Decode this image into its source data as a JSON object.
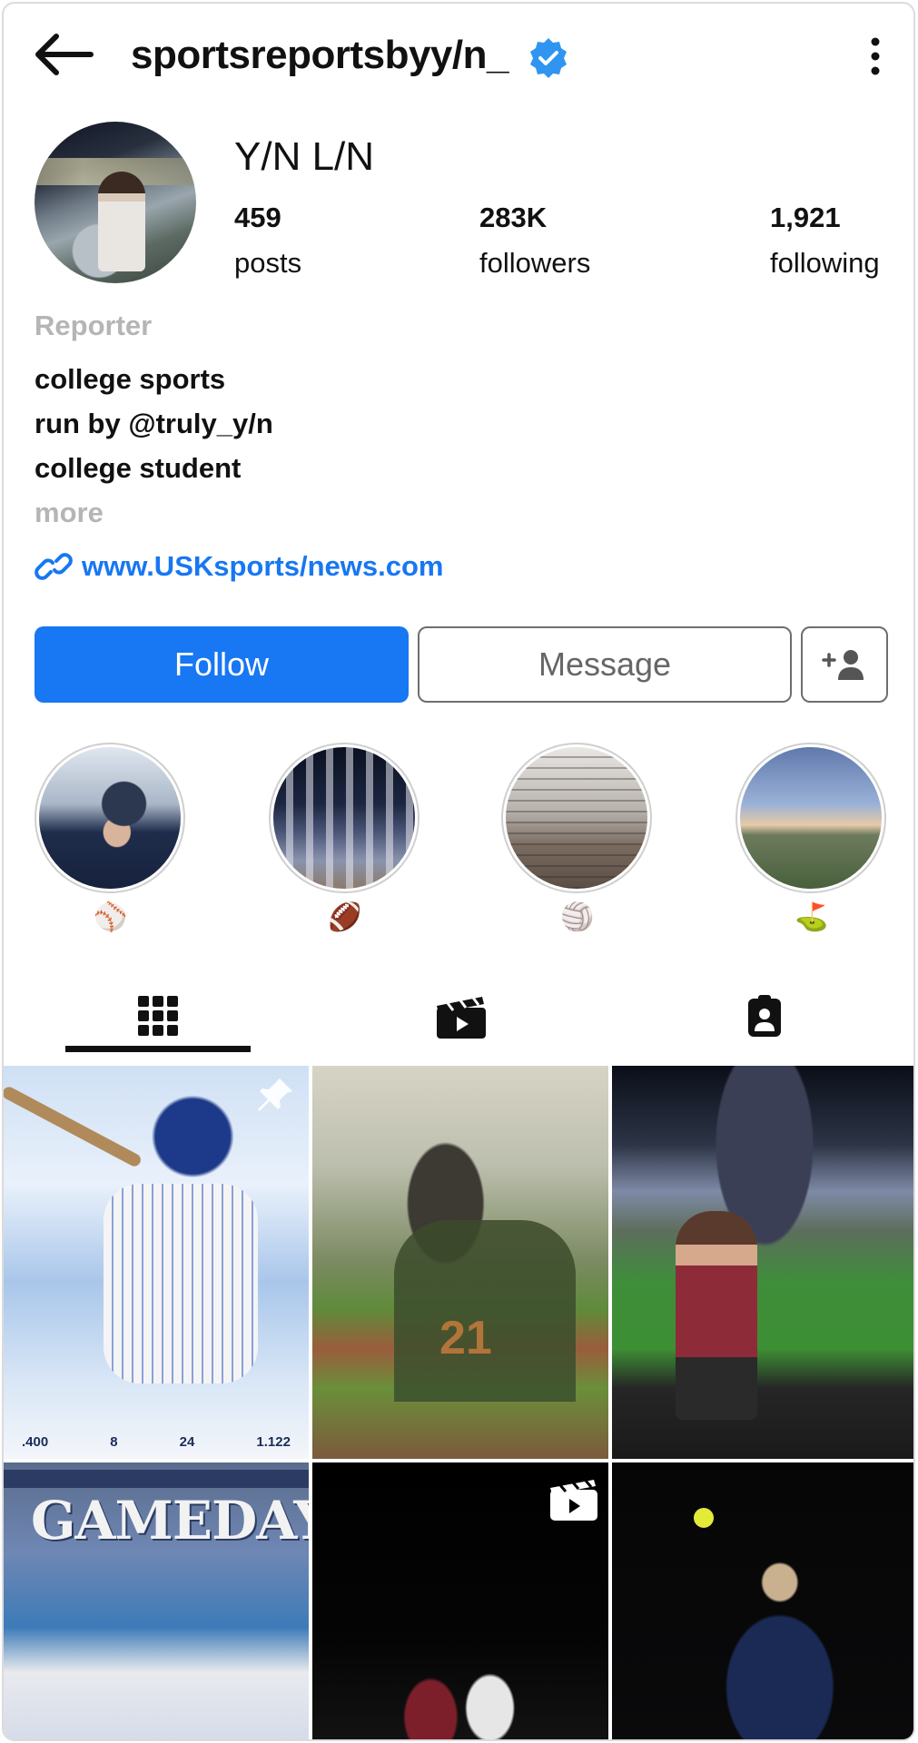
{
  "header": {
    "username": "sportsreportsbyy/n_",
    "verified": true,
    "icons": [
      "back-arrow-icon",
      "verified-badge-icon",
      "more-options-icon"
    ]
  },
  "profile": {
    "display_name": "Y/N L/N",
    "stats": [
      {
        "value": "459",
        "label": "posts"
      },
      {
        "value": "283K",
        "label": "followers"
      },
      {
        "value": "1,921",
        "label": "following"
      }
    ],
    "category": "Reporter",
    "bio_lines": [
      "college sports",
      "run by @truly_y/n",
      "college student"
    ],
    "more_label": "more",
    "link": "www.USKsports/news.com"
  },
  "actions": {
    "follow_label": "Follow",
    "message_label": "Message",
    "add_user_icon": "add-person-icon"
  },
  "highlights": [
    {
      "emoji": "⚾",
      "topic": "baseball"
    },
    {
      "emoji": "🏈",
      "topic": "football"
    },
    {
      "emoji": "🏐",
      "topic": "volleyball"
    },
    {
      "emoji": "⛳",
      "topic": "golf"
    }
  ],
  "tabs": [
    {
      "icon": "grid-icon",
      "active": true
    },
    {
      "icon": "reels-icon",
      "active": false
    },
    {
      "icon": "tagged-icon",
      "active": false
    }
  ],
  "posts": {
    "post1": {
      "stats": [
        ".400",
        "8",
        "24",
        "1.122"
      ],
      "pinned": true
    },
    "post2": {
      "jersey_number": "21"
    },
    "post4": {
      "title": "GAMEDAY"
    },
    "post5": {
      "is_reel": true
    }
  },
  "colors": {
    "accent": "#1877f2",
    "muted": "#b5b5b5",
    "border": "#6e6e6e"
  }
}
